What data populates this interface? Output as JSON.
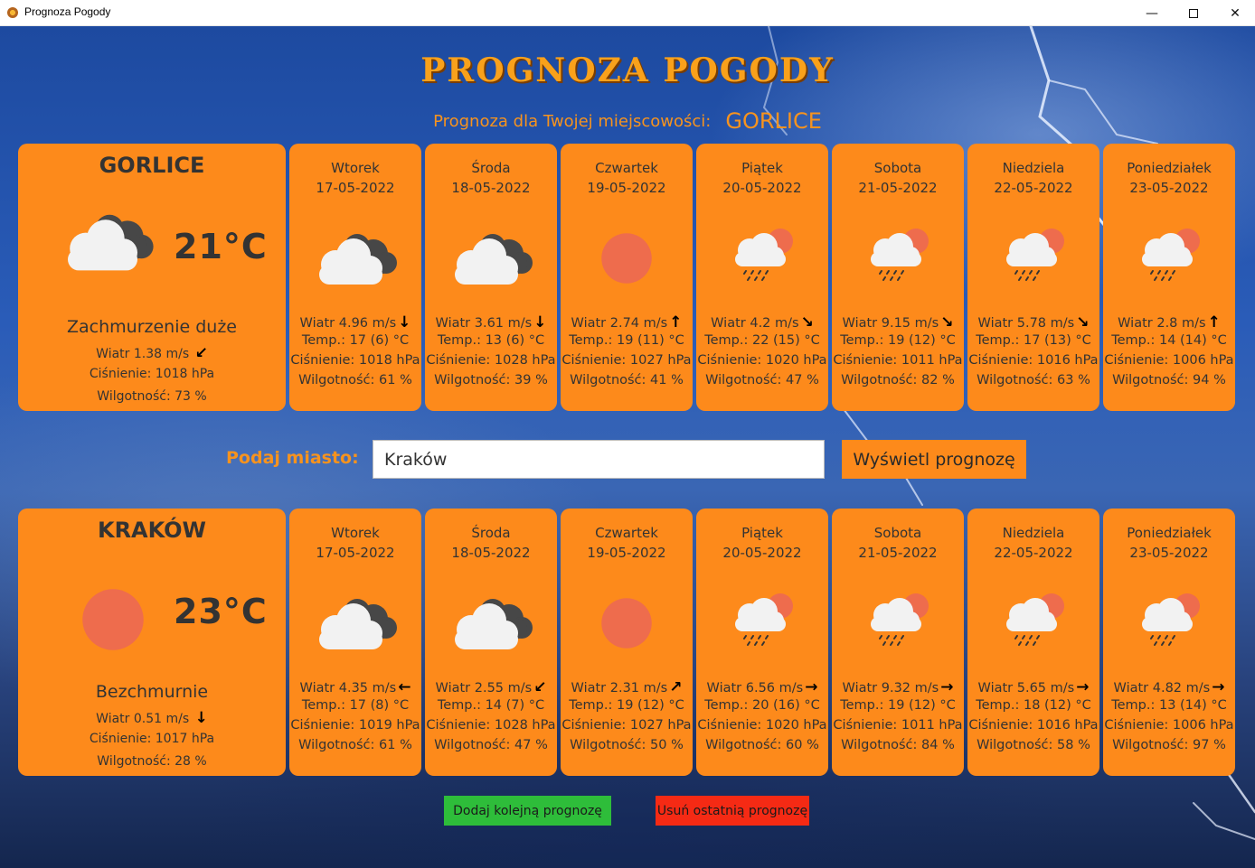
{
  "window": {
    "title": "Prognoza Pogody",
    "minimize": "—",
    "close": "✕"
  },
  "header": {
    "title": "PROGNOZA POGODY",
    "subtitle": "Prognoza dla Twojej miejscowości:",
    "city": "GORLICE"
  },
  "colors": {
    "card": "#fd8a1b",
    "heading": "#f9a11b",
    "add_button": "#2ebd3a",
    "remove_button": "#f52a14",
    "sun": "#ee6c4d"
  },
  "forecasts": [
    {
      "city": "GORLICE",
      "current": {
        "temp": "21°C",
        "icon": "cloud-icon",
        "desc": "Zachmurzenie duże",
        "wind": "Wiatr 1.38 m/s",
        "wind_arrow": "↙",
        "pressure": "Ciśnienie: 1018 hPa",
        "humidity": "Wilgotność: 73 %"
      },
      "days": [
        {
          "name": "Wtorek",
          "date": "17-05-2022",
          "icon": "cloud-icon",
          "wind": "Wiatr 4.96 m/s",
          "arrow": "↓",
          "temp": "Temp.: 17 (6) °C",
          "pressure": "Ciśnienie: 1018 hPa",
          "humidity": "Wilgotność: 61 %"
        },
        {
          "name": "Środa",
          "date": "18-05-2022",
          "icon": "cloud-icon",
          "wind": "Wiatr 3.61 m/s",
          "arrow": "↓",
          "temp": "Temp.: 13 (6) °C",
          "pressure": "Ciśnienie: 1028 hPa",
          "humidity": "Wilgotność: 39 %"
        },
        {
          "name": "Czwartek",
          "date": "19-05-2022",
          "icon": "sun-icon",
          "wind": "Wiatr 2.74 m/s",
          "arrow": "↑",
          "temp": "Temp.: 19 (11) °C",
          "pressure": "Ciśnienie: 1027 hPa",
          "humidity": "Wilgotność: 41 %"
        },
        {
          "name": "Piątek",
          "date": "20-05-2022",
          "icon": "rain-icon",
          "wind": "Wiatr 4.2 m/s",
          "arrow": "↘",
          "temp": "Temp.: 22 (15) °C",
          "pressure": "Ciśnienie: 1020 hPa",
          "humidity": "Wilgotność: 47 %"
        },
        {
          "name": "Sobota",
          "date": "21-05-2022",
          "icon": "rain-icon",
          "wind": "Wiatr 9.15 m/s",
          "arrow": "↘",
          "temp": "Temp.: 19 (12) °C",
          "pressure": "Ciśnienie: 1011 hPa",
          "humidity": "Wilgotność: 82 %"
        },
        {
          "name": "Niedziela",
          "date": "22-05-2022",
          "icon": "rain-icon",
          "wind": "Wiatr 5.78 m/s",
          "arrow": "↘",
          "temp": "Temp.: 17 (13) °C",
          "pressure": "Ciśnienie: 1016 hPa",
          "humidity": "Wilgotność: 63 %"
        },
        {
          "name": "Poniedziałek",
          "date": "23-05-2022",
          "icon": "rain-icon",
          "wind": "Wiatr 2.8 m/s",
          "arrow": "↑",
          "temp": "Temp.: 14 (14) °C",
          "pressure": "Ciśnienie: 1006 hPa",
          "humidity": "Wilgotność: 94 %"
        }
      ]
    },
    {
      "city": "KRAKÓW",
      "current": {
        "temp": "23°C",
        "icon": "sun-icon",
        "desc": "Bezchmurnie",
        "wind": "Wiatr 0.51 m/s",
        "wind_arrow": "↓",
        "pressure": "Ciśnienie: 1017 hPa",
        "humidity": "Wilgotność: 28 %"
      },
      "days": [
        {
          "name": "Wtorek",
          "date": "17-05-2022",
          "icon": "cloud-icon",
          "wind": "Wiatr 4.35 m/s",
          "arrow": "←",
          "temp": "Temp.: 17 (8) °C",
          "pressure": "Ciśnienie: 1019 hPa",
          "humidity": "Wilgotność: 61 %"
        },
        {
          "name": "Środa",
          "date": "18-05-2022",
          "icon": "cloud-icon",
          "wind": "Wiatr 2.55 m/s",
          "arrow": "↙",
          "temp": "Temp.: 14 (7) °C",
          "pressure": "Ciśnienie: 1028 hPa",
          "humidity": "Wilgotność: 47 %"
        },
        {
          "name": "Czwartek",
          "date": "19-05-2022",
          "icon": "sun-icon",
          "wind": "Wiatr 2.31 m/s",
          "arrow": "↗",
          "temp": "Temp.: 19 (12) °C",
          "pressure": "Ciśnienie: 1027 hPa",
          "humidity": "Wilgotność: 50 %"
        },
        {
          "name": "Piątek",
          "date": "20-05-2022",
          "icon": "rain-icon",
          "wind": "Wiatr 6.56 m/s",
          "arrow": "→",
          "temp": "Temp.: 20 (16) °C",
          "pressure": "Ciśnienie: 1020 hPa",
          "humidity": "Wilgotność: 60 %"
        },
        {
          "name": "Sobota",
          "date": "21-05-2022",
          "icon": "rain-icon",
          "wind": "Wiatr 9.32 m/s",
          "arrow": "→",
          "temp": "Temp.: 19 (12) °C",
          "pressure": "Ciśnienie: 1011 hPa",
          "humidity": "Wilgotność: 84 %"
        },
        {
          "name": "Niedziela",
          "date": "22-05-2022",
          "icon": "rain-icon",
          "wind": "Wiatr 5.65 m/s",
          "arrow": "→",
          "temp": "Temp.: 18 (12) °C",
          "pressure": "Ciśnienie: 1016 hPa",
          "humidity": "Wilgotność: 58 %"
        },
        {
          "name": "Poniedziałek",
          "date": "23-05-2022",
          "icon": "rain-icon",
          "wind": "Wiatr 4.82 m/s",
          "arrow": "→",
          "temp": "Temp.: 13 (14) °C",
          "pressure": "Ciśnienie: 1006 hPa",
          "humidity": "Wilgotność: 97 %"
        }
      ]
    }
  ],
  "form": {
    "label": "Podaj miasto:",
    "input_value": "Kraków",
    "submit_label": "Wyświetl prognozę"
  },
  "actions": {
    "add_label": "Dodaj kolejną prognozę",
    "remove_label": "Usuń ostatnią prognozę"
  }
}
